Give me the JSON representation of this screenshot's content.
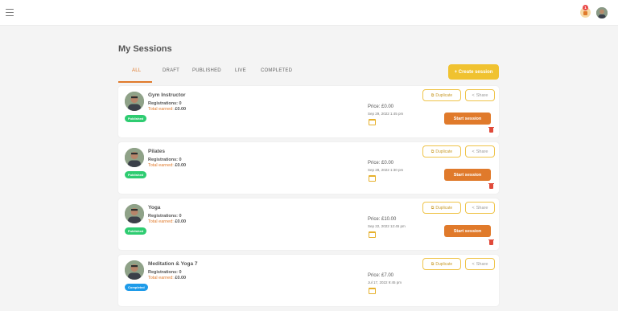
{
  "header": {
    "notification_count": "1"
  },
  "page": {
    "title": "My Sessions",
    "create_button": "+ Create session"
  },
  "tabs": [
    {
      "label": "ALL",
      "active": true
    },
    {
      "label": "DRAFT",
      "active": false
    },
    {
      "label": "PUBLISHED",
      "active": false
    },
    {
      "label": "LIVE",
      "active": false
    },
    {
      "label": "COMPLETED",
      "active": false
    }
  ],
  "labels": {
    "registrations": "Registrations:",
    "total_earned": "Total earned:",
    "duplicate": "Duplicate",
    "share": "Share",
    "start_session": "Start session"
  },
  "sessions": [
    {
      "name": "Gym Instructor",
      "registrations": "0",
      "earned": "£0.00",
      "status": "Published",
      "price": "Price: £0.00",
      "date": "Sep 29, 2022 1:45 pm"
    },
    {
      "name": "Pilates",
      "registrations": "0",
      "earned": "£0.00",
      "status": "Published",
      "price": "Price: £0.00",
      "date": "Sep 28, 2022 1:30 pm"
    },
    {
      "name": "Yoga",
      "registrations": "0",
      "earned": "£0.00",
      "status": "Published",
      "price": "Price: £10.00",
      "date": "Sep 22, 2022 12:45 pm"
    },
    {
      "name": "Meditation & Yoga 7",
      "registrations": "0",
      "earned": "£0.00",
      "status": "Completed",
      "price": "Price: £7.00",
      "date": "Jul 17, 2022 9:45 pm"
    }
  ],
  "colors": {
    "accent": "#e07a2b",
    "create": "#f0c230",
    "published": "#2ecc71",
    "completed": "#1e9be9"
  }
}
